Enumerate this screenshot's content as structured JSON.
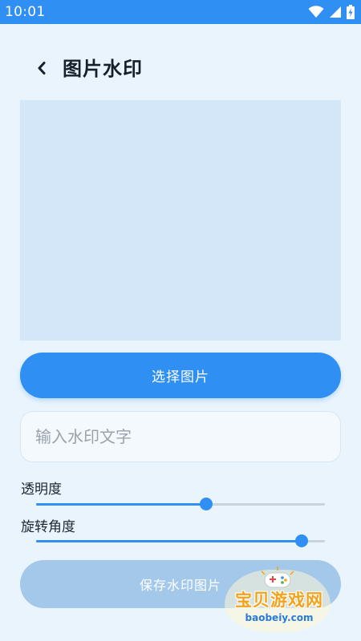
{
  "status_bar": {
    "time": "10:01",
    "icons": [
      "wifi-icon",
      "signal-icon",
      "battery-icon"
    ]
  },
  "header": {
    "back_icon": "chevron-left-icon",
    "title": "图片水印"
  },
  "select_button": {
    "label": "选择图片"
  },
  "watermark_input": {
    "placeholder": "输入水印文字",
    "value": ""
  },
  "sliders": {
    "opacity": {
      "label": "透明度",
      "value": 0.59
    },
    "rotation": {
      "label": "旋转角度",
      "value": 0.92
    }
  },
  "save_button": {
    "label": "保存水印图片"
  },
  "site_watermark": {
    "title": "宝贝游戏网",
    "url": "baobeiy.com"
  },
  "colors": {
    "accent": "#2f8ff2",
    "background": "#eaf4fd",
    "preview": "#d3e7f8",
    "save_disabled": "#a3c8ea"
  }
}
